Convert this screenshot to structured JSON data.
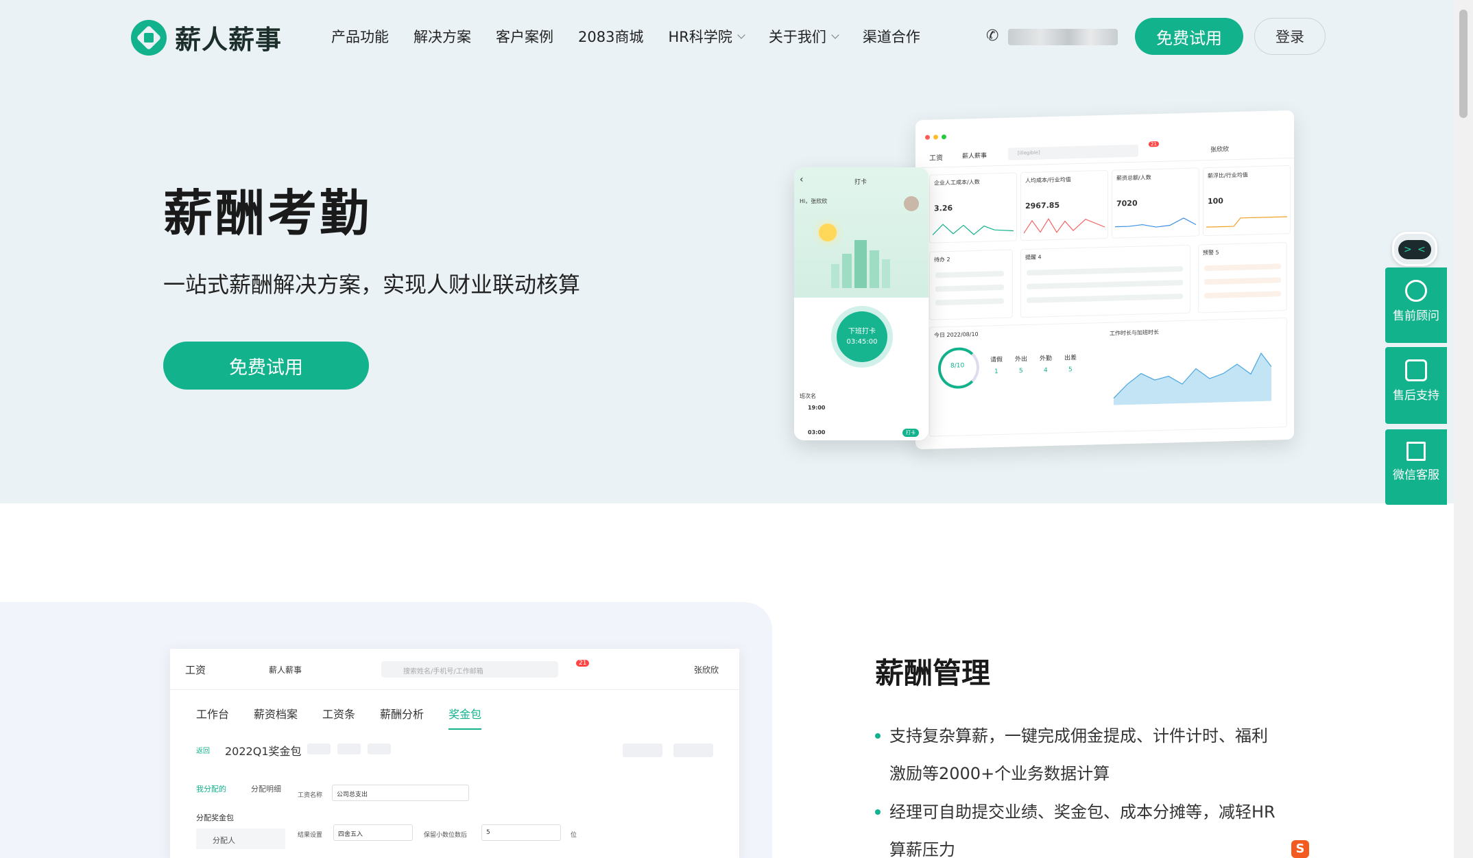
{
  "brand": {
    "name": "薪人薪事",
    "accent": "#12b28c"
  },
  "nav": {
    "items": [
      {
        "label": "产品功能",
        "dropdown": false
      },
      {
        "label": "解决方案",
        "dropdown": false
      },
      {
        "label": "客户案例",
        "dropdown": false
      },
      {
        "label": "2083商城",
        "dropdown": false
      },
      {
        "label": "HR科学院",
        "dropdown": true
      },
      {
        "label": "关于我们",
        "dropdown": true
      },
      {
        "label": "渠道合作",
        "dropdown": false
      }
    ],
    "trial_label": "免费试用",
    "login_label": "登录"
  },
  "hero": {
    "title": "薪酬考勤",
    "subtitle": "一站式薪酬解决方案，实现人财业联动核算",
    "cta_label": "免费试用"
  },
  "dashboard": {
    "module": "工资",
    "company": "薪人薪事",
    "search_placeholder": "[illegible]",
    "badge": "21",
    "user": "张欣欣",
    "kpis": [
      {
        "label": "企业人工成本/人数",
        "value": "3.26"
      },
      {
        "label": "人均成本/行业均值",
        "value": "2967.85"
      },
      {
        "label": "薪资总额/人数",
        "value": "7020"
      },
      {
        "label": "薪浮比/行业均值",
        "value": "100"
      }
    ],
    "lists": [
      {
        "label": "待办 2"
      },
      {
        "label": "提醒 4"
      },
      {
        "label": "预警 5"
      }
    ],
    "today": "今日 2022/08/10",
    "ring": "8/10",
    "stats": [
      {
        "label": "请假",
        "value": "1"
      },
      {
        "label": "外出",
        "value": "5"
      },
      {
        "label": "外勤",
        "value": "4"
      },
      {
        "label": "出差",
        "value": "5"
      }
    ],
    "chart_title": "工作时长与加班时长"
  },
  "phone": {
    "title": "打卡",
    "greeting": "Hi，张欣欣",
    "clock_label": "下班打卡",
    "clock_time": "03:45:00",
    "shift_label": "班次名",
    "time_a": "19:00",
    "time_b": "03:00",
    "punch": "打卡"
  },
  "salary_app": {
    "module": "工资",
    "company": "薪人薪事",
    "search_placeholder": "搜索姓名/手机号/工作邮箱",
    "badge": "21",
    "user": "张欣欣",
    "tabs": [
      "工作台",
      "薪资档案",
      "工资条",
      "薪酬分析",
      "奖金包"
    ],
    "active_tab": 4,
    "back_label": "返回",
    "package_title": "2022Q1奖金包",
    "subtabs": [
      "我分配的",
      "分配明细"
    ],
    "section": "分配奖金包",
    "assignee": "分配人",
    "field_label": "工资名称",
    "field_value": "公司总支出",
    "rounding_label": "结果设置",
    "rounding_value": "四舍五入",
    "decimal_label": "保留小数位数后",
    "decimal_value": "5",
    "unit": "位"
  },
  "feature": {
    "title": "薪酬管理",
    "bullets": [
      {
        "line1": "支持复杂算薪，一键完成佣金提成、计件计时、福利",
        "line2": "激励等2000+个业务数据计算"
      },
      {
        "line1": "经理可自助提交业绩、奖金包、成本分摊等，减轻HR",
        "line2": "算薪压力"
      }
    ]
  },
  "side_widget": {
    "items": [
      "售前顾问",
      "售后支持",
      "微信客服"
    ]
  }
}
